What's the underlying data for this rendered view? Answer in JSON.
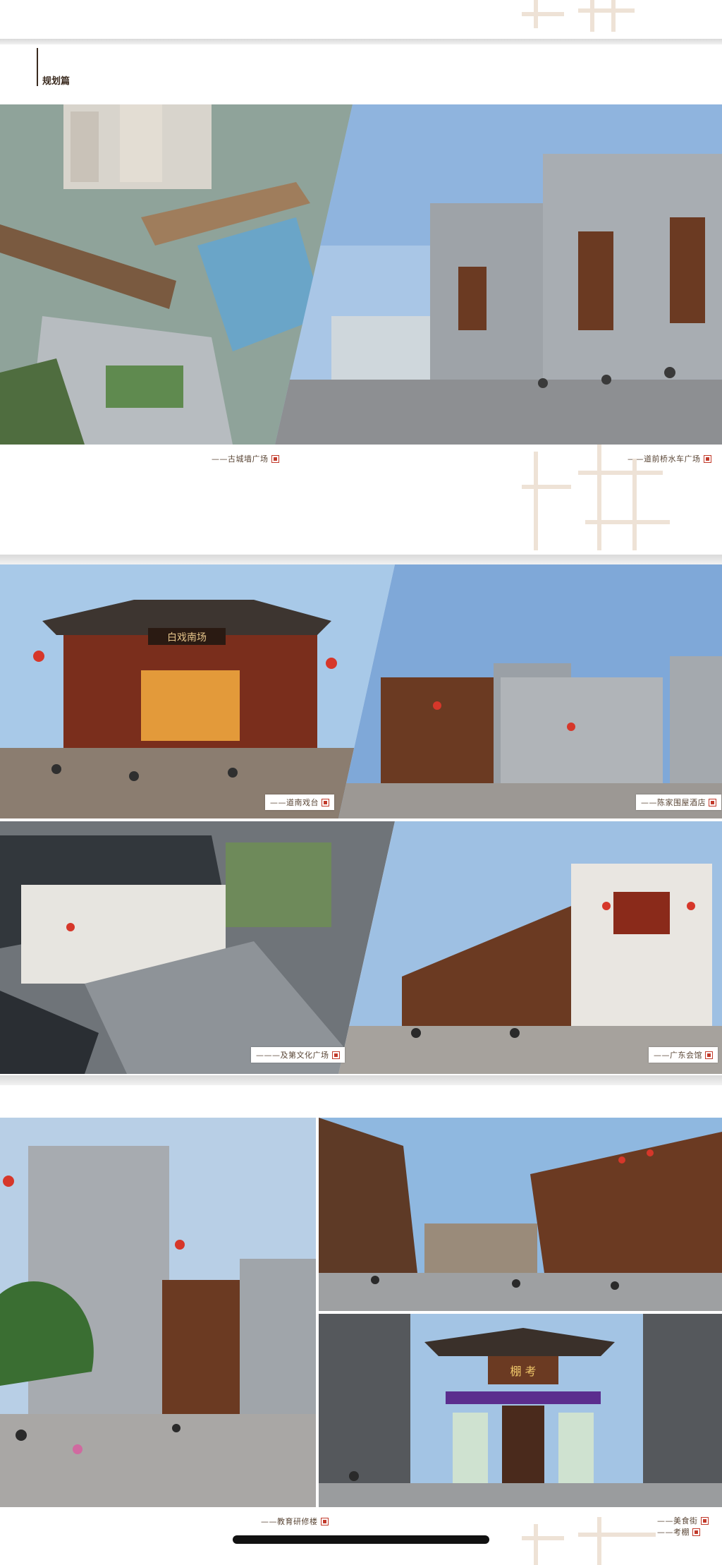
{
  "section": {
    "title": "规划篇"
  },
  "captions": {
    "c1": "——古城墙广场",
    "c2": "——道前桥水车广场",
    "c3": "——道南戏台",
    "c4": "——陈家围屋酒店",
    "c5": "———及第文化广场",
    "c6": "——广东会馆",
    "c7": "——教育研修楼",
    "c8": "——美食街",
    "c9": "——考棚"
  },
  "signs": {
    "stage": "白戏南场",
    "gate": "棚 考"
  },
  "icons": [
    "seal-icon",
    "chinese-character-watermark"
  ],
  "colors": {
    "caption_text": "#5a4636",
    "seal_red": "#c23a2b",
    "sky_blue": "#8fb4de",
    "brick_gray": "#9ea3a8",
    "wood_brown": "#6b3a22",
    "lantern_red": "#d6372a",
    "home_indicator": "#111111"
  }
}
